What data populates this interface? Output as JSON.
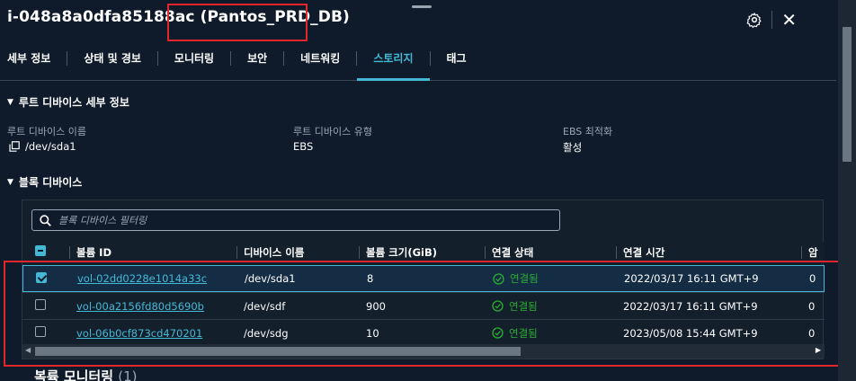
{
  "instance": {
    "id": "i-048a8a0dfa85188ac",
    "name": "(Pantos_PRD_DB)"
  },
  "icons": {
    "settings": "gear-icon",
    "close": "close-icon",
    "copy": "copy-icon",
    "search": "search-icon",
    "status_ok": "check-circle-icon"
  },
  "colors": {
    "accent": "#44b9d6",
    "success": "#29ad32",
    "highlight": "#e3262b",
    "background": "#0f1b2a"
  },
  "tabs": [
    {
      "label": "세부 정보"
    },
    {
      "label": "상태 및 경보"
    },
    {
      "label": "모니터링"
    },
    {
      "label": "보안"
    },
    {
      "label": "네트워킹"
    },
    {
      "label": "스토리지",
      "active": true
    },
    {
      "label": "태그"
    }
  ],
  "root_device": {
    "section_title": "루트 디바이스 세부 정보",
    "name_label": "루트 디바이스 이름",
    "name_value": "/dev/sda1",
    "type_label": "루트 디바이스 유형",
    "type_value": "EBS",
    "ebs_label": "EBS 최적화",
    "ebs_value": "활성"
  },
  "block_devices": {
    "section_title": "블록 디바이스",
    "search_placeholder": "블록 디바이스 필터링",
    "columns": [
      "볼륨 ID",
      "디바이스 이름",
      "볼륨 크기(GiB)",
      "연결 상태",
      "연결 시간",
      "암"
    ],
    "rows": [
      {
        "volume_id": "vol-02dd0228e1014a33c",
        "device": "/dev/sda1",
        "size": "8",
        "status": "연결됨",
        "time": "2022/03/17 16:11 GMT+9",
        "extra": "0",
        "selected": true
      },
      {
        "volume_id": "vol-00a2156fd80d5690b",
        "device": "/dev/sdf",
        "size": "900",
        "status": "연결됨",
        "time": "2022/03/17 16:11 GMT+9",
        "extra": "0",
        "selected": false
      },
      {
        "volume_id": "vol-06b0cf873cd470201",
        "device": "/dev/sdg",
        "size": "10",
        "status": "연결됨",
        "time": "2023/05/08 15:44 GMT+9",
        "extra": "0",
        "selected": false
      }
    ]
  },
  "recent": {
    "title": "복륙 모니터링",
    "count": "(1)"
  }
}
